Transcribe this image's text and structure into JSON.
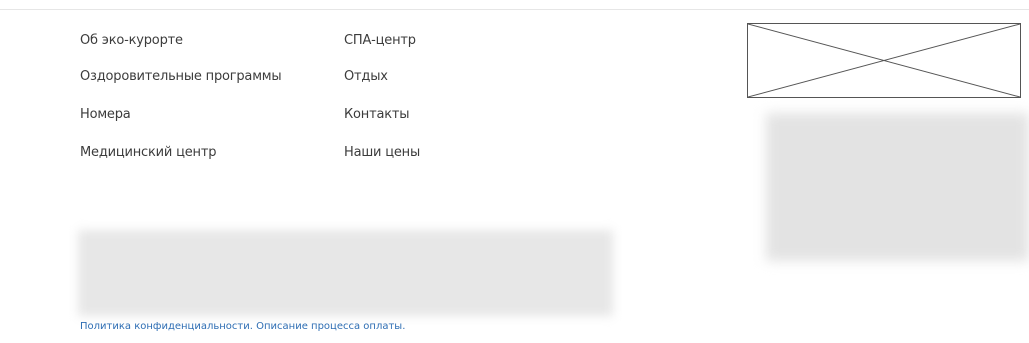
{
  "footer": {
    "nav_col1": [
      "Об эко-курорте",
      "Оздоровительные программы",
      "Номера",
      "Медицинский центр"
    ],
    "nav_col2": [
      "СПА-центр",
      "Отдых",
      "Контакты",
      "Наши цены"
    ],
    "policy_link": "Политика конфиденциальности.",
    "payment_link": "Описание процесса оплаты.",
    "colors": {
      "nav_text": "#3c3c3c",
      "link": "#2d6db3",
      "placeholder_border": "#555555",
      "blurred_area": "#e5e5e5"
    }
  }
}
